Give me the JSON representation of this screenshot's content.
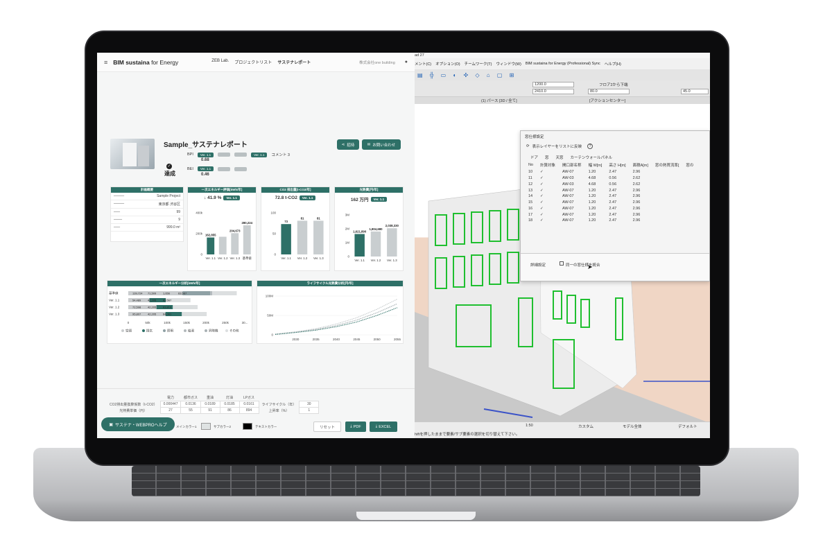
{
  "app": {
    "brand_bold": "BIM sustaina",
    "brand_rest": " for Energy",
    "nav_links": [
      "ZEB Lab.",
      "プロジェクトリスト",
      "サステナレポート"
    ],
    "company": "株式会社one building"
  },
  "report": {
    "title": "Sample_サステナレポート",
    "achieved": "達成",
    "bpi_label": "BPI",
    "bpi_value": "0.68",
    "bei_label": "BEI",
    "bei_value": "0.46",
    "ver_tag": "Ver. 1.1",
    "comment_label": "コメント 3",
    "share_button": "招待",
    "contact_button": "お問い合わせ"
  },
  "summary": {
    "header": "計画概要",
    "rows": [
      {
        "value": "Sample Project"
      },
      {
        "value": "東京都 渋谷区"
      },
      {
        "value": "99"
      },
      {
        "value": "9"
      },
      {
        "value": "999.0 m²"
      }
    ]
  },
  "cards": {
    "energy_header": "一次エネルギー評価[kWh/年]",
    "energy_value": "↓ 41.9 %",
    "co2_header": "CO2 排出量[t-CO2/年]",
    "co2_value": "72.8 t-CO2",
    "cost_header": "光熱費[円/年]",
    "cost_value": "162 万円",
    "ver_tag": "Ver. 1.1",
    "analysis_header": "一次エネルギー分析[kWh/年]",
    "lifecycle_header": "ライフサイクル光熱費分析[円/年]"
  },
  "chart_data": [
    {
      "type": "bar",
      "title": "一次エネルギー評価[kWh/年]",
      "categories": [
        "Ver. 1.1",
        "Ver. 1.2",
        "Ver. 1.3",
        "基準値"
      ],
      "values": [
        162855,
        170000,
        204673,
        280224
      ],
      "labels": [
        "162,855",
        "",
        "204,673",
        "280,224"
      ],
      "yticks": [
        "0",
        "200k",
        "400k"
      ],
      "ylim": [
        0,
        400000
      ]
    },
    {
      "type": "bar",
      "title": "CO2 排出量[t-CO2/年]",
      "categories": [
        "Ver. 1.1",
        "Ver. 1.2",
        "Ver. 1.3"
      ],
      "values": [
        73,
        81,
        81
      ],
      "labels": [
        "73",
        "81",
        "81"
      ],
      "yticks": [
        "0",
        "50",
        "100"
      ],
      "ylim": [
        0,
        100
      ]
    },
    {
      "type": "bar",
      "title": "光熱費[円/年]",
      "categories": [
        "Ver. 1.1",
        "Ver. 1.2",
        "Ver. 1.3"
      ],
      "values": [
        1621890,
        1804680,
        2038330
      ],
      "labels": [
        "1,621,890",
        "1,804,680",
        "2,038,330"
      ],
      "yticks": [
        "0",
        "1M",
        "2M",
        "3M"
      ],
      "ylim": [
        0,
        3000000
      ]
    },
    {
      "type": "bar",
      "orientation": "horizontal-stacked",
      "title": "一次エネルギー分析[kWh/年]",
      "categories": [
        "基準値",
        "Ver. 1.1",
        "Ver. 1.2",
        "Ver. 1.3"
      ],
      "series": [
        {
          "name": "空調",
          "values": [
            139724,
            54489,
            72598,
            95807
          ],
          "color": "#c9ccce"
        },
        {
          "name": "換気",
          "values": [
            0,
            42205,
            42205,
            42205
          ],
          "color": "#2e7067"
        },
        {
          "name": "照明",
          "values": [
            71509,
            0,
            0,
            0
          ],
          "color": "#8fa1a5"
        },
        {
          "name": "給湯",
          "values": [
            3000,
            0,
            0,
            0
          ],
          "color": "#b3b9bc"
        },
        {
          "name": "昇降機",
          "values": [
            1656,
            0,
            0,
            0
          ],
          "color": "#a9b2b5"
        },
        {
          "name": "その他",
          "values": [
            63567,
            63567,
            63819,
            64061
          ],
          "color": "#dcdfe0"
        }
      ],
      "labels": [
        [
          "139,724",
          "71,509",
          "1,656",
          "63,567"
        ],
        [
          "54,489",
          "42,205",
          "63,567"
        ],
        [
          "72,598",
          "42,205",
          "63,819"
        ],
        [
          "95,807",
          "42,205",
          "64,061"
        ]
      ],
      "xticks": [
        "0",
        "50k",
        "100k",
        "150k",
        "200k",
        "250k",
        "30..."
      ],
      "xlim": [
        0,
        300000
      ],
      "legend": "bottom"
    },
    {
      "type": "line",
      "title": "ライフサイクル光熱費分析[円/年]",
      "x": [
        2025,
        2030,
        2035,
        2040,
        2045,
        2050,
        2055
      ],
      "series": [
        {
          "values": [
            2,
            8,
            16,
            28,
            44,
            66,
            92
          ],
          "color": "#c2c7c9"
        },
        {
          "values": [
            2,
            7,
            14,
            24,
            38,
            57,
            80
          ],
          "color": "#9aa5a8"
        },
        {
          "values": [
            1,
            6,
            12,
            21,
            33,
            50,
            70
          ],
          "color": "#2e7067"
        }
      ],
      "xticks": [
        "2030",
        "2035",
        "2040",
        "2045",
        "2050",
        "2055"
      ],
      "yticks": [
        "0",
        "50M",
        "100M"
      ],
      "ylim": [
        0,
        100
      ]
    }
  ],
  "bottom_table": {
    "columns": [
      "電力",
      "都市ガス",
      "重油",
      "灯油",
      "LPガス"
    ],
    "row1_label": "CO2排出量換算係数（t-CO2）",
    "row1": [
      "0.000447",
      "0.0136",
      "0.0189",
      "0.0185",
      "0.0161"
    ],
    "row2_label": "光熱費単価（円）",
    "row2": [
      "27",
      "55",
      "91",
      "86",
      "894"
    ],
    "lifecycle_label": "ライフサイクル（年）",
    "lifecycle_value": "30",
    "rise_label": "上昇率（%）",
    "rise_value": "1"
  },
  "controls": {
    "help": "サステナ・WEBPROヘルプ",
    "color1_label": "メインカラー1",
    "color2_label": "サブカラー2",
    "text_color_label": "テキストカラー",
    "reset": "リセット",
    "pdf": "PDF",
    "excel": "EXCEL"
  },
  "cad": {
    "title_fragment": "ad 27",
    "menus": [
      "メント(C)",
      "オプション(O)",
      "チームワーク(T)",
      "ウィンドウ(W)",
      "BIM sustaina for Energy (Professional) Sync",
      "ヘルプ(H)"
    ],
    "dim1": "1200.0",
    "dim2": "2410.0",
    "floor_label": "フロア2から下端",
    "floor_value": "80.0",
    "angle_value": "45.0",
    "tab_perspective": "(1) パース [3D / 全て]",
    "tab_action": "[アクションセンター]",
    "dialog_title": "窓仕様設定",
    "reflect_layer": "表示レイヤーをリストに反映",
    "tabs": [
      "ドア",
      "窓",
      "天窓",
      "カーテンウォールパネル"
    ],
    "columns": [
      "No",
      "計算対象",
      "開口部名称",
      "幅 W[m]",
      "高さ H[m]",
      "面積A[m]",
      "窓の熱貫流率[",
      "窓の"
    ],
    "rows": [
      [
        "10",
        "✓",
        "AW-07",
        "1.20",
        "2.47",
        "2.96"
      ],
      [
        "11",
        "✓",
        "AW-03",
        "4.68",
        "0.56",
        "2.62"
      ],
      [
        "12",
        "✓",
        "AW-03",
        "4.68",
        "0.56",
        "2.62"
      ],
      [
        "13",
        "✓",
        "AW-07",
        "1.20",
        "2.47",
        "2.96"
      ],
      [
        "14",
        "✓",
        "AW-07",
        "1.20",
        "2.47",
        "2.96"
      ],
      [
        "15",
        "✓",
        "AW-07",
        "1.20",
        "2.47",
        "2.96"
      ],
      [
        "16",
        "✓",
        "AW-07",
        "1.20",
        "2.47",
        "2.96"
      ],
      [
        "17",
        "✓",
        "AW-07",
        "1.20",
        "2.47",
        "2.96"
      ],
      [
        "18",
        "✓",
        "AW-07",
        "1.20",
        "2.47",
        "2.96"
      ]
    ],
    "detail_button": "詳細設定",
    "merge_checkbox": "同一の窓仕様を統合",
    "scale": "1:50",
    "custom": "カスタム",
    "model_all": "モデル全体",
    "default": "デフォルト",
    "status_text": "hiftを押したままで要素/サブ要素の選択を切り替えて下さい。"
  },
  "colors": {
    "accent": "#2e7067"
  }
}
